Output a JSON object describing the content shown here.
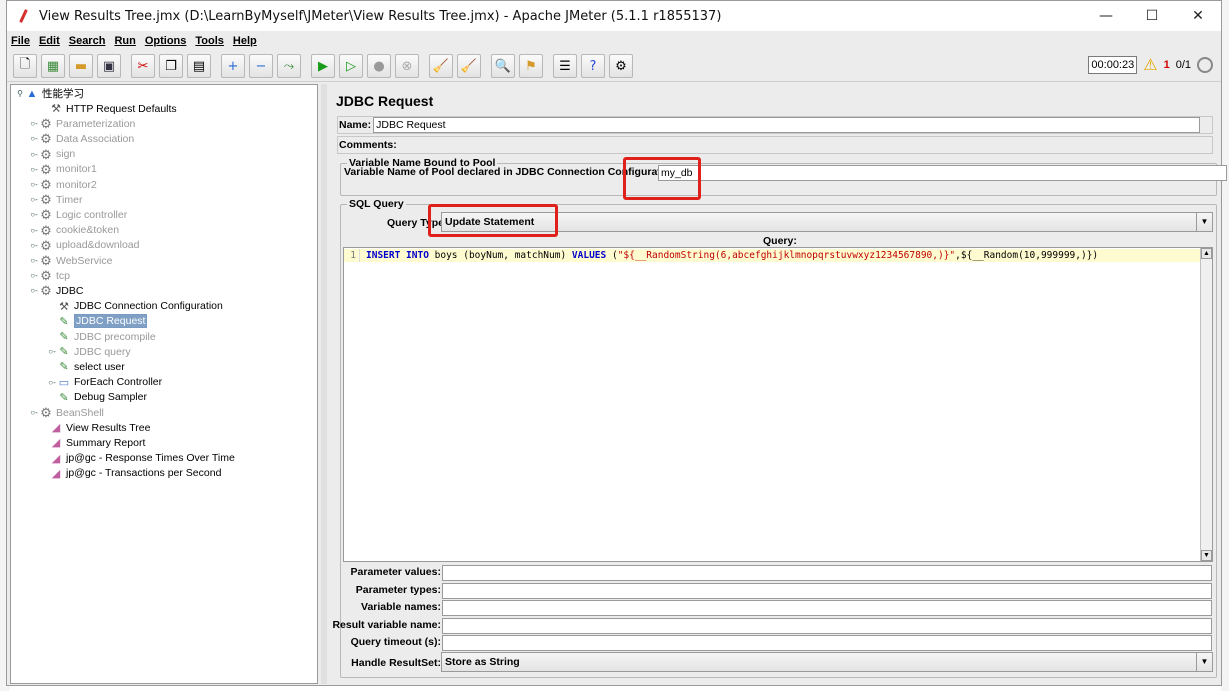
{
  "window": {
    "title": "View Results Tree.jmx (D:\\LearnByMyself\\JMeter\\View Results Tree.jmx) - Apache JMeter (5.1.1 r1855137)",
    "controls": {
      "minimize": "—",
      "maximize": "☐",
      "close": "✕"
    }
  },
  "menu": [
    "File",
    "Edit",
    "Search",
    "Run",
    "Options",
    "Tools",
    "Help"
  ],
  "toolbar": {
    "timer": "00:00:23",
    "error_count": "1",
    "threads": "0/1"
  },
  "tree": {
    "root": "性能学习",
    "items": [
      {
        "label": "HTTP Request Defaults",
        "icon": "wrench-icon",
        "level": 1,
        "disabled": false,
        "expandable": false
      },
      {
        "label": "Parameterization",
        "icon": "gear-icon",
        "level": 0,
        "disabled": true,
        "expandable": true
      },
      {
        "label": "Data Association",
        "icon": "gear-icon",
        "level": 0,
        "disabled": true,
        "expandable": true
      },
      {
        "label": "sign",
        "icon": "gear-icon",
        "level": 0,
        "disabled": true,
        "expandable": true
      },
      {
        "label": "monitor1",
        "icon": "gear-icon",
        "level": 0,
        "disabled": true,
        "expandable": true
      },
      {
        "label": "monitor2",
        "icon": "gear-icon",
        "level": 0,
        "disabled": true,
        "expandable": true
      },
      {
        "label": "Timer",
        "icon": "gear-icon",
        "level": 0,
        "disabled": true,
        "expandable": true
      },
      {
        "label": "Logic controller",
        "icon": "gear-icon",
        "level": 0,
        "disabled": true,
        "expandable": true
      },
      {
        "label": "cookie&token",
        "icon": "gear-icon",
        "level": 0,
        "disabled": true,
        "expandable": true
      },
      {
        "label": "upload&download",
        "icon": "gear-icon",
        "level": 0,
        "disabled": true,
        "expandable": true
      },
      {
        "label": "WebService",
        "icon": "gear-icon",
        "level": 0,
        "disabled": true,
        "expandable": true
      },
      {
        "label": "tcp",
        "icon": "gear-icon",
        "level": 0,
        "disabled": true,
        "expandable": true
      },
      {
        "label": "JDBC",
        "icon": "gear-icon",
        "level": 0,
        "disabled": false,
        "expandable": true
      },
      {
        "label": "JDBC Connection Configuration",
        "icon": "wrench-icon",
        "level": 2,
        "disabled": false,
        "expandable": false
      },
      {
        "label": "JDBC Request",
        "icon": "pen-icon",
        "level": 2,
        "disabled": true,
        "expandable": false,
        "selected": true
      },
      {
        "label": "JDBC precompile",
        "icon": "pen-icon",
        "level": 2,
        "disabled": true,
        "expandable": false
      },
      {
        "label": "JDBC query",
        "icon": "pen-icon",
        "level": 2,
        "disabled": true,
        "expandable": true
      },
      {
        "label": "select user",
        "icon": "pen-icon",
        "level": 2,
        "disabled": false,
        "expandable": false
      },
      {
        "label": "ForEach Controller",
        "icon": "foreach-icon",
        "level": 2,
        "disabled": false,
        "expandable": true
      },
      {
        "label": "Debug Sampler",
        "icon": "pen-icon",
        "level": 2,
        "disabled": false,
        "expandable": false
      },
      {
        "label": "BeanShell",
        "icon": "gear-icon",
        "level": 0,
        "disabled": true,
        "expandable": true
      },
      {
        "label": "View Results Tree",
        "icon": "chart-icon",
        "level": 1,
        "disabled": false,
        "expandable": false
      },
      {
        "label": "Summary Report",
        "icon": "chart-icon",
        "level": 1,
        "disabled": false,
        "expandable": false
      },
      {
        "label": "jp@gc - Response Times Over Time",
        "icon": "chart-icon",
        "level": 1,
        "disabled": false,
        "expandable": false
      },
      {
        "label": "jp@gc - Transactions per Second",
        "icon": "chart-icon",
        "level": 1,
        "disabled": false,
        "expandable": false
      }
    ]
  },
  "panel": {
    "title": "JDBC Request",
    "name_label": "Name:",
    "name_value": "JDBC Request",
    "comments_label": "Comments:",
    "comments_value": "",
    "pool_group": "Variable Name Bound to Pool",
    "pool_label": "Variable Name of Pool declared in JDBC Connection Configuration:",
    "pool_value": "my_db",
    "sql_group": "SQL Query",
    "query_type_label": "Query Type:",
    "query_type_value": "Update Statement",
    "query_label": "Query:",
    "sql": {
      "line_no": "1",
      "kw1": "INSERT INTO",
      "t1": " boys (boyNum, matchNum) ",
      "kw2": "VALUES",
      "t2": " (",
      "s1": "\"${__RandomString(6,abcefghijklmnopqrstuvwxyz1234567890,)}\"",
      "t3": ",${__Random(10,999999,)})"
    },
    "params": [
      {
        "label": "Parameter values:",
        "value": ""
      },
      {
        "label": "Parameter types:",
        "value": ""
      },
      {
        "label": "Variable names:",
        "value": ""
      },
      {
        "label": "Result variable name:",
        "value": ""
      },
      {
        "label": "Query timeout (s):",
        "value": ""
      }
    ],
    "handle_resultset_label": "Handle ResultSet:",
    "handle_resultset_value": "Store as String"
  },
  "colors": {
    "highlight": "#e0201a",
    "keyword": "#0000cc",
    "string": "#c00000",
    "sql_line_bg": "#fffbd0"
  }
}
